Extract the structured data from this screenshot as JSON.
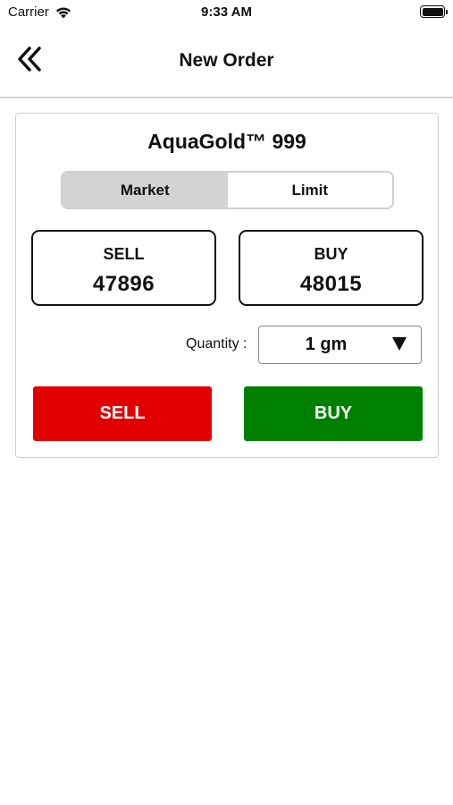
{
  "status_bar": {
    "carrier": "Carrier",
    "time": "9:33 AM",
    "wifi_icon": "wifi-icon",
    "battery_icon": "battery-icon"
  },
  "nav": {
    "title": "New Order",
    "back_icon": "double-chevron-left-icon"
  },
  "order": {
    "product": "AquaGold™ 999",
    "order_types": [
      {
        "label": "Market",
        "selected": true
      },
      {
        "label": "Limit",
        "selected": false
      }
    ],
    "sell_label": "SELL",
    "sell_price": "47896",
    "buy_label": "BUY",
    "buy_price": "48015",
    "quantity_label": "Quantity :",
    "quantity_value": "1 gm",
    "sell_button": "SELL",
    "buy_button": "BUY"
  },
  "colors": {
    "sell": "#e00000",
    "buy": "#008000",
    "segment_active": "#d3d3d3"
  }
}
